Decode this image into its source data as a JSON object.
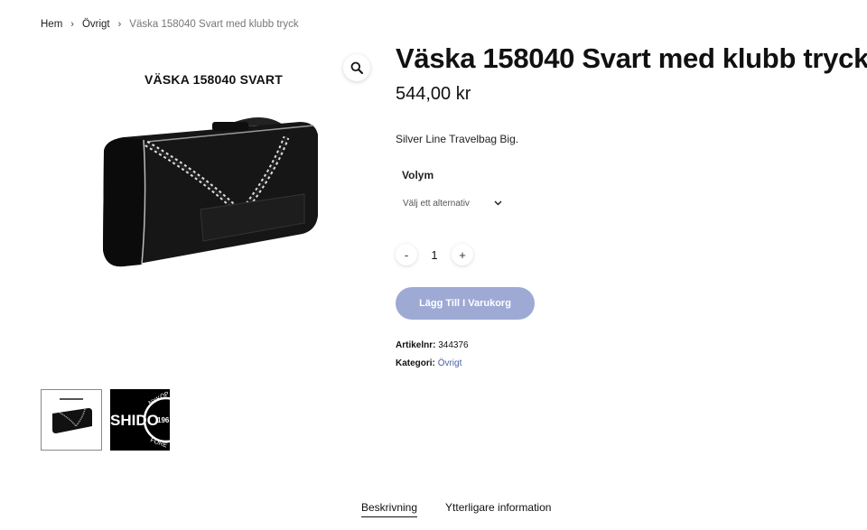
{
  "breadcrumb": {
    "home": "Hem",
    "category": "Övrigt",
    "current": "Väska 158040 Svart med klubb tryck"
  },
  "gallery": {
    "main_caption": "VÄSKA 158040 SVART",
    "thumb2_text": "SHIDO",
    "thumb2_small_top": "NYKÖP",
    "thumb2_small_side": "196",
    "thumb2_small_bottom": "FÖRE"
  },
  "product": {
    "title": "Väska 158040 Svart med klubb tryck",
    "price": "544,00 kr",
    "short_description": "Silver Line Travelbag Big.",
    "variant_label": "Volym",
    "variant_placeholder": "Välj ett alternativ",
    "quantity": "1",
    "minus": "-",
    "plus": "+",
    "add_to_cart": "Lägg Till I Varukorg",
    "sku_label": "Artikelnr:",
    "sku_value": "344376",
    "category_label": "Kategori:",
    "category_value": "Övrigt"
  },
  "tabs": [
    {
      "label": "Beskrivning"
    },
    {
      "label": "Ytterligare information"
    }
  ],
  "colors": {
    "button": "#9eaad4",
    "link": "#4a5fa6"
  }
}
